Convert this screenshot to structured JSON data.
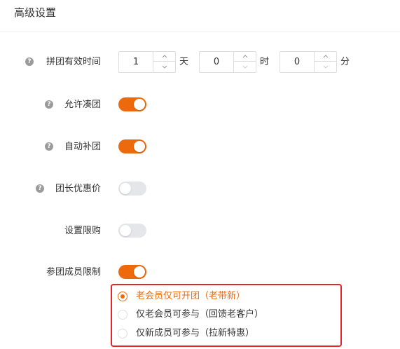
{
  "header": {
    "title": "高级设置"
  },
  "fields": {
    "validity": {
      "label": "拼团有效时间",
      "days": "1",
      "days_unit": "天",
      "hours": "0",
      "hours_unit": "时",
      "minutes": "0",
      "minutes_unit": "分"
    },
    "allow_join": {
      "label": "允许凑团",
      "on": true
    },
    "auto_fill": {
      "label": "自动补团",
      "on": true
    },
    "leader_discount": {
      "label": "团长优惠价",
      "on": false
    },
    "purchase_limit": {
      "label": "设置限购",
      "on": false
    },
    "member_limit": {
      "label": "参团成员限制",
      "on": true
    }
  },
  "member_options": [
    {
      "label": "老会员仅可开团（老带新）",
      "checked": true
    },
    {
      "label": "仅老会员可参与（回馈老客户）",
      "checked": false
    },
    {
      "label": "仅新成员可参与（拉新特惠）",
      "checked": false
    }
  ],
  "colors": {
    "accent": "#ed6a0c",
    "switch_off": "#e5e6ea",
    "highlight_border": "#e0262b"
  },
  "icons": {
    "help": "help-circle-icon",
    "step_up": "chevron-up-icon",
    "step_down": "chevron-down-icon"
  }
}
